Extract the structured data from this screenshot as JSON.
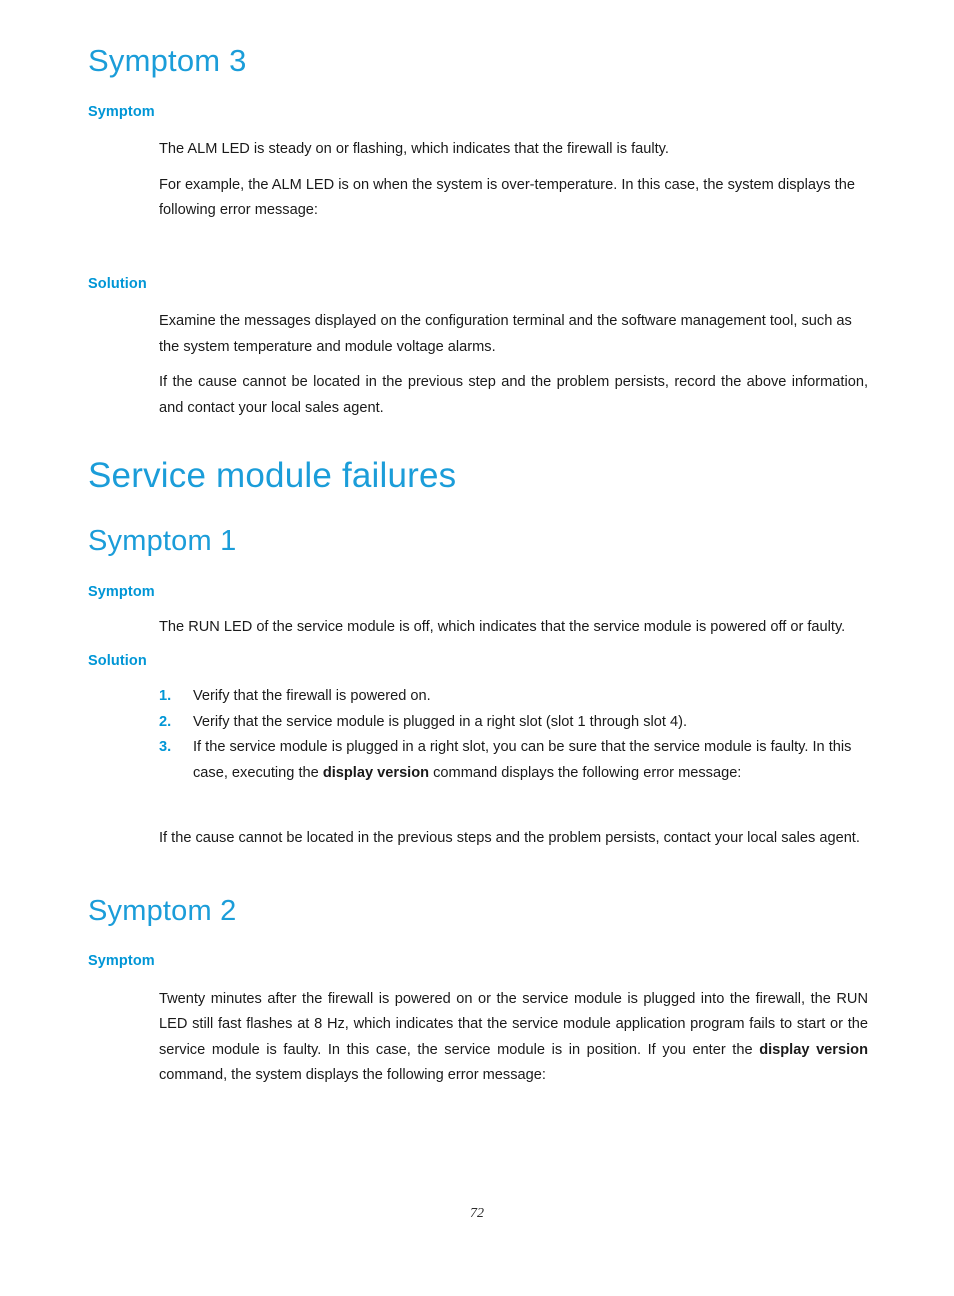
{
  "document": {
    "page_number": "72",
    "accent_heading_color": "#1b9dd9",
    "accent_subheading_color": "#0096d6",
    "body_text_color": "#1a1a1a",
    "background_color": "#ffffff"
  },
  "sections": [
    {
      "heading": "Symptom 3",
      "symptom_label": "Symptom",
      "symptom_paragraphs": [
        "The ALM LED is steady on or flashing, which indicates that the firewall is faulty.",
        "For example, the ALM LED is on when the system is over-temperature. In this case, the system displays the following error message:"
      ],
      "solution_label": "Solution",
      "solution_paragraphs": [
        "Examine the messages displayed on the configuration terminal and the software management tool, such as the system temperature and module voltage alarms.",
        "If the cause cannot be located in the previous step and the problem persists, record the above information, and contact your local sales agent."
      ]
    }
  ],
  "chapter": {
    "title": "Service module failures"
  },
  "symptom1": {
    "heading": "Symptom 1",
    "symptom_label": "Symptom",
    "symptom_paragraph": "The RUN LED of the service module is off, which indicates that the service module is powered off or faulty.",
    "solution_label": "Solution",
    "steps": [
      {
        "number": "1.",
        "text_parts": [
          {
            "text": "Verify that the firewall is powered on.",
            "bold": false
          }
        ]
      },
      {
        "number": "2.",
        "text_parts": [
          {
            "text": "Verify that the service module is plugged in a right slot (slot 1 through slot 4).",
            "bold": false
          }
        ]
      },
      {
        "number": "3.",
        "text_parts": [
          {
            "text": "If the service module is plugged in a right slot, you can be sure that the service module is faulty. In this case, executing the ",
            "bold": false
          },
          {
            "text": "display version",
            "bold": true
          },
          {
            "text": " command displays the following error message:",
            "bold": false
          }
        ]
      }
    ],
    "closing_paragraph": "If the cause cannot be located in the previous steps and the problem persists, contact your local sales agent."
  },
  "symptom2": {
    "heading": "Symptom 2",
    "symptom_label": "Symptom",
    "symptom_paragraph_parts": [
      {
        "text": "Twenty minutes after the firewall is powered on or the service module is plugged into the firewall, the RUN LED still fast flashes at 8 Hz, which indicates that the service module application program fails to start or the service module is faulty. In this case, the service module is in position. If you enter the ",
        "bold": false
      },
      {
        "text": "display version",
        "bold": true
      },
      {
        "text": " command, the system displays the following error message:",
        "bold": false
      }
    ]
  }
}
